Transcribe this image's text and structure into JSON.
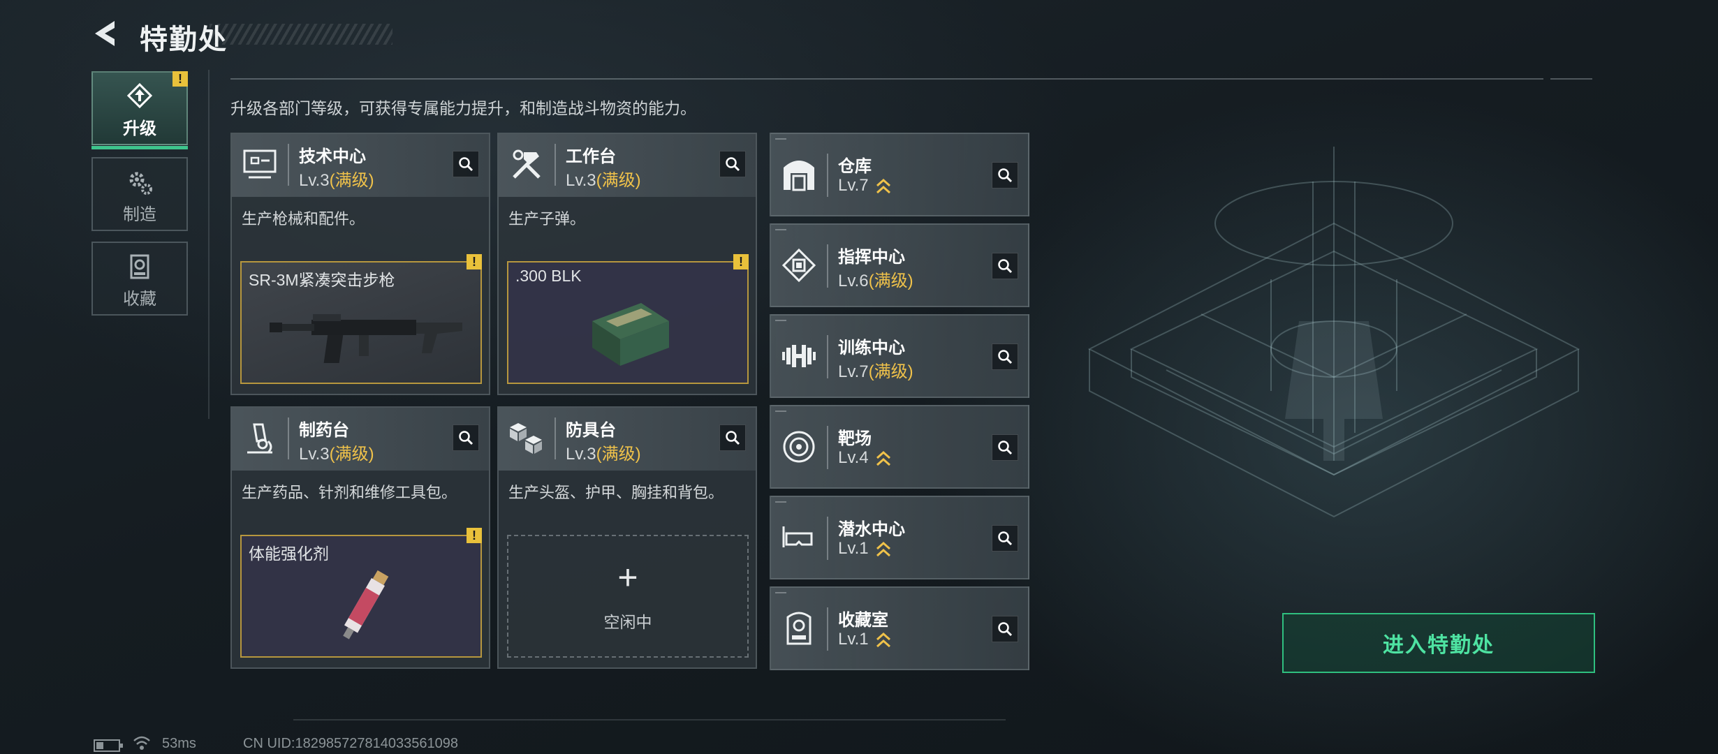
{
  "header": {
    "title": "特勤处"
  },
  "side_tabs": [
    {
      "label": "升级",
      "icon": "upgrade-icon",
      "active": true,
      "warning": "!"
    },
    {
      "label": "制造",
      "icon": "gears-icon",
      "active": false
    },
    {
      "label": "收藏",
      "icon": "collection-icon",
      "active": false
    }
  ],
  "description": "升级各部门等级，可获得专属能力提升，和制造战斗物资的能力。",
  "large_departments": [
    {
      "name": "技术中心",
      "level": "Lv.3",
      "maxed": "(满级)",
      "icon": "monitor-icon",
      "desc": "生产枪械和配件。",
      "product": "SR-3M紧凑突击步枪",
      "product_icon": "rifle-icon",
      "warning": "!"
    },
    {
      "name": "工作台",
      "level": "Lv.3",
      "maxed": "(满级)",
      "icon": "hammer-wrench-icon",
      "desc": "生产子弹。",
      "product": ".300 BLK",
      "product_icon": "ammo-box-icon",
      "warning": "!"
    },
    {
      "name": "制药台",
      "level": "Lv.3",
      "maxed": "(满级)",
      "icon": "microscope-icon",
      "desc": "生产药品、针剂和维修工具包。",
      "product": "体能强化剂",
      "product_icon": "syringe-icon",
      "warning": "!"
    },
    {
      "name": "防具台",
      "level": "Lv.3",
      "maxed": "(满级)",
      "icon": "boxes-icon",
      "desc": "生产头盔、护甲、胸挂和背包。",
      "empty_plus": "+",
      "empty_label": "空闲中"
    }
  ],
  "small_departments": [
    {
      "name": "仓库",
      "level": "Lv.7",
      "maxed": "",
      "upgradable": true,
      "icon": "warehouse-icon"
    },
    {
      "name": "指挥中心",
      "level": "Lv.6",
      "maxed": "(满级)",
      "upgradable": false,
      "icon": "chip-icon"
    },
    {
      "name": "训练中心",
      "level": "Lv.7",
      "maxed": "(满级)",
      "upgradable": false,
      "icon": "dumbbell-icon"
    },
    {
      "name": "靶场",
      "level": "Lv.4",
      "maxed": "",
      "upgradable": true,
      "icon": "target-icon"
    },
    {
      "name": "潜水中心",
      "level": "Lv.1",
      "maxed": "",
      "upgradable": true,
      "icon": "diving-mask-icon"
    },
    {
      "name": "收藏室",
      "level": "Lv.1",
      "maxed": "",
      "upgradable": true,
      "icon": "display-case-icon"
    }
  ],
  "enter_button": "进入特勤处",
  "status": {
    "ping": "53ms",
    "uid": "CN UID:1829857278140335610​98"
  },
  "colors": {
    "accent_green": "#3ec58d",
    "maxed_gold": "#f0c24a",
    "warning_yellow": "#e9c13b"
  }
}
